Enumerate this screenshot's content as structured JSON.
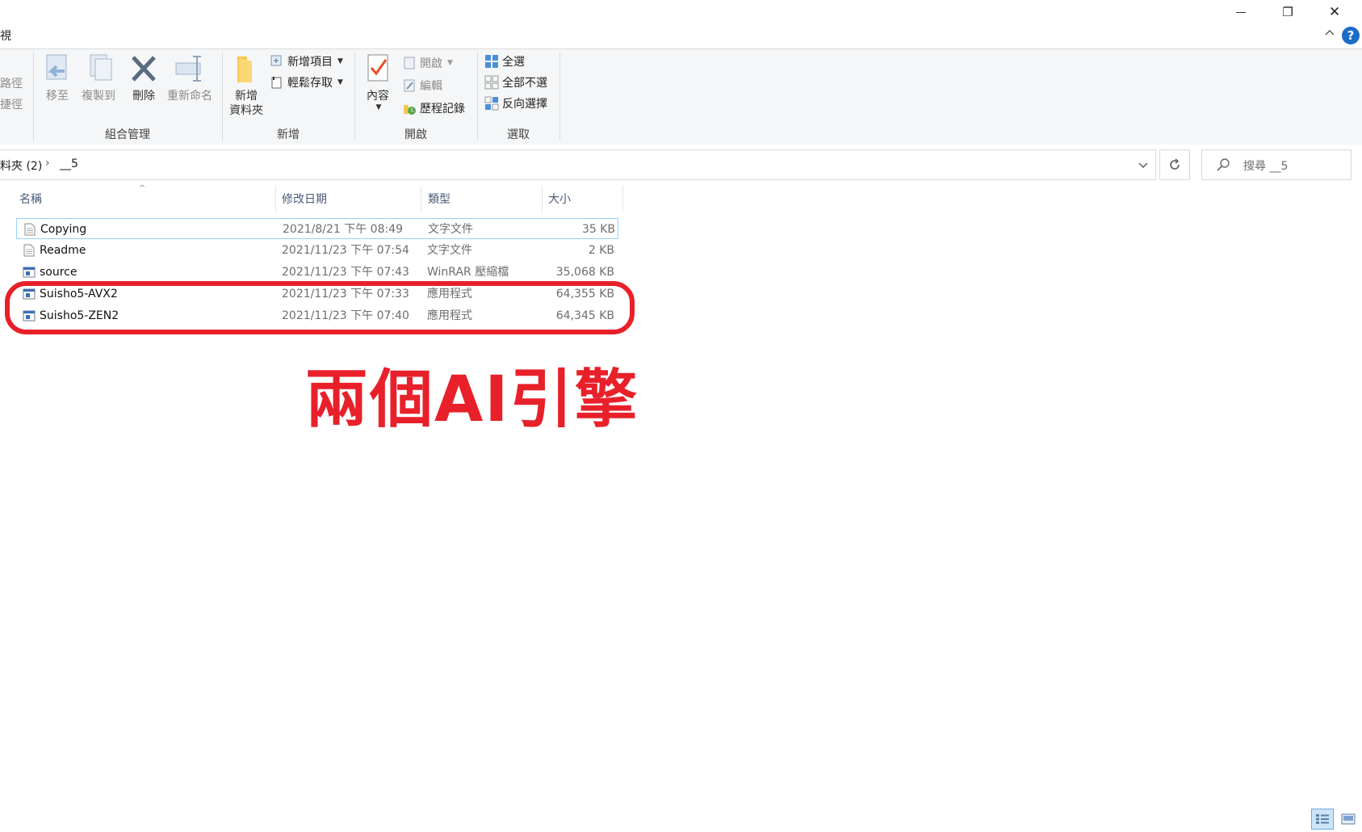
{
  "tabs": {
    "view": "視"
  },
  "window": {
    "minimize": "—",
    "restore": "❐",
    "close": "✕"
  },
  "ribbon": {
    "groups": {
      "organize": "組合管理",
      "new": "新增",
      "open": "開啟",
      "select": "選取"
    },
    "clip_partial": [
      "路徑",
      "捷徑"
    ],
    "organize": {
      "move_to": "移至",
      "copy_to": "複製到",
      "delete": "刪除",
      "rename": "重新命名"
    },
    "new": {
      "new_folder_line1": "新增",
      "new_folder_line2": "資料夾",
      "new_item": "新增項目",
      "easy_access": "輕鬆存取"
    },
    "open": {
      "properties": "內容",
      "open": "開啟",
      "edit": "編輯",
      "history": "歷程記錄"
    },
    "select": {
      "select_all": "全選",
      "select_none": "全部不選",
      "invert": "反向選擇"
    }
  },
  "address": {
    "parent": "料夾 (2)",
    "separator": "›",
    "current": "__5"
  },
  "search": {
    "placeholder": "搜尋 __5"
  },
  "columns": {
    "name": "名稱",
    "date": "修改日期",
    "type": "類型",
    "size": "大小"
  },
  "files": [
    {
      "name": "Copying",
      "date": "2021/8/21 下午 08:49",
      "type": "文字文件",
      "size": "35 KB",
      "icon": "text-file-icon"
    },
    {
      "name": "Readme",
      "date": "2021/11/23 下午 07:54",
      "type": "文字文件",
      "size": "2 KB",
      "icon": "text-file-icon"
    },
    {
      "name": "source",
      "date": "2021/11/23 下午 07:43",
      "type": "WinRAR 壓縮檔",
      "size": "35,068 KB",
      "icon": "archive-icon"
    },
    {
      "name": "Suisho5-AVX2",
      "date": "2021/11/23 下午 07:33",
      "type": "應用程式",
      "size": "64,355 KB",
      "icon": "app-icon"
    },
    {
      "name": "Suisho5-ZEN2",
      "date": "2021/11/23 下午 07:40",
      "type": "應用程式",
      "size": "64,345 KB",
      "icon": "app-icon"
    }
  ],
  "annotation": {
    "text": "兩個AI引擎",
    "color": "#e8202a"
  },
  "colors": {
    "accent": "#1a6dc6",
    "highlight": "#e8202a",
    "selection_border": "#99d1ff"
  }
}
